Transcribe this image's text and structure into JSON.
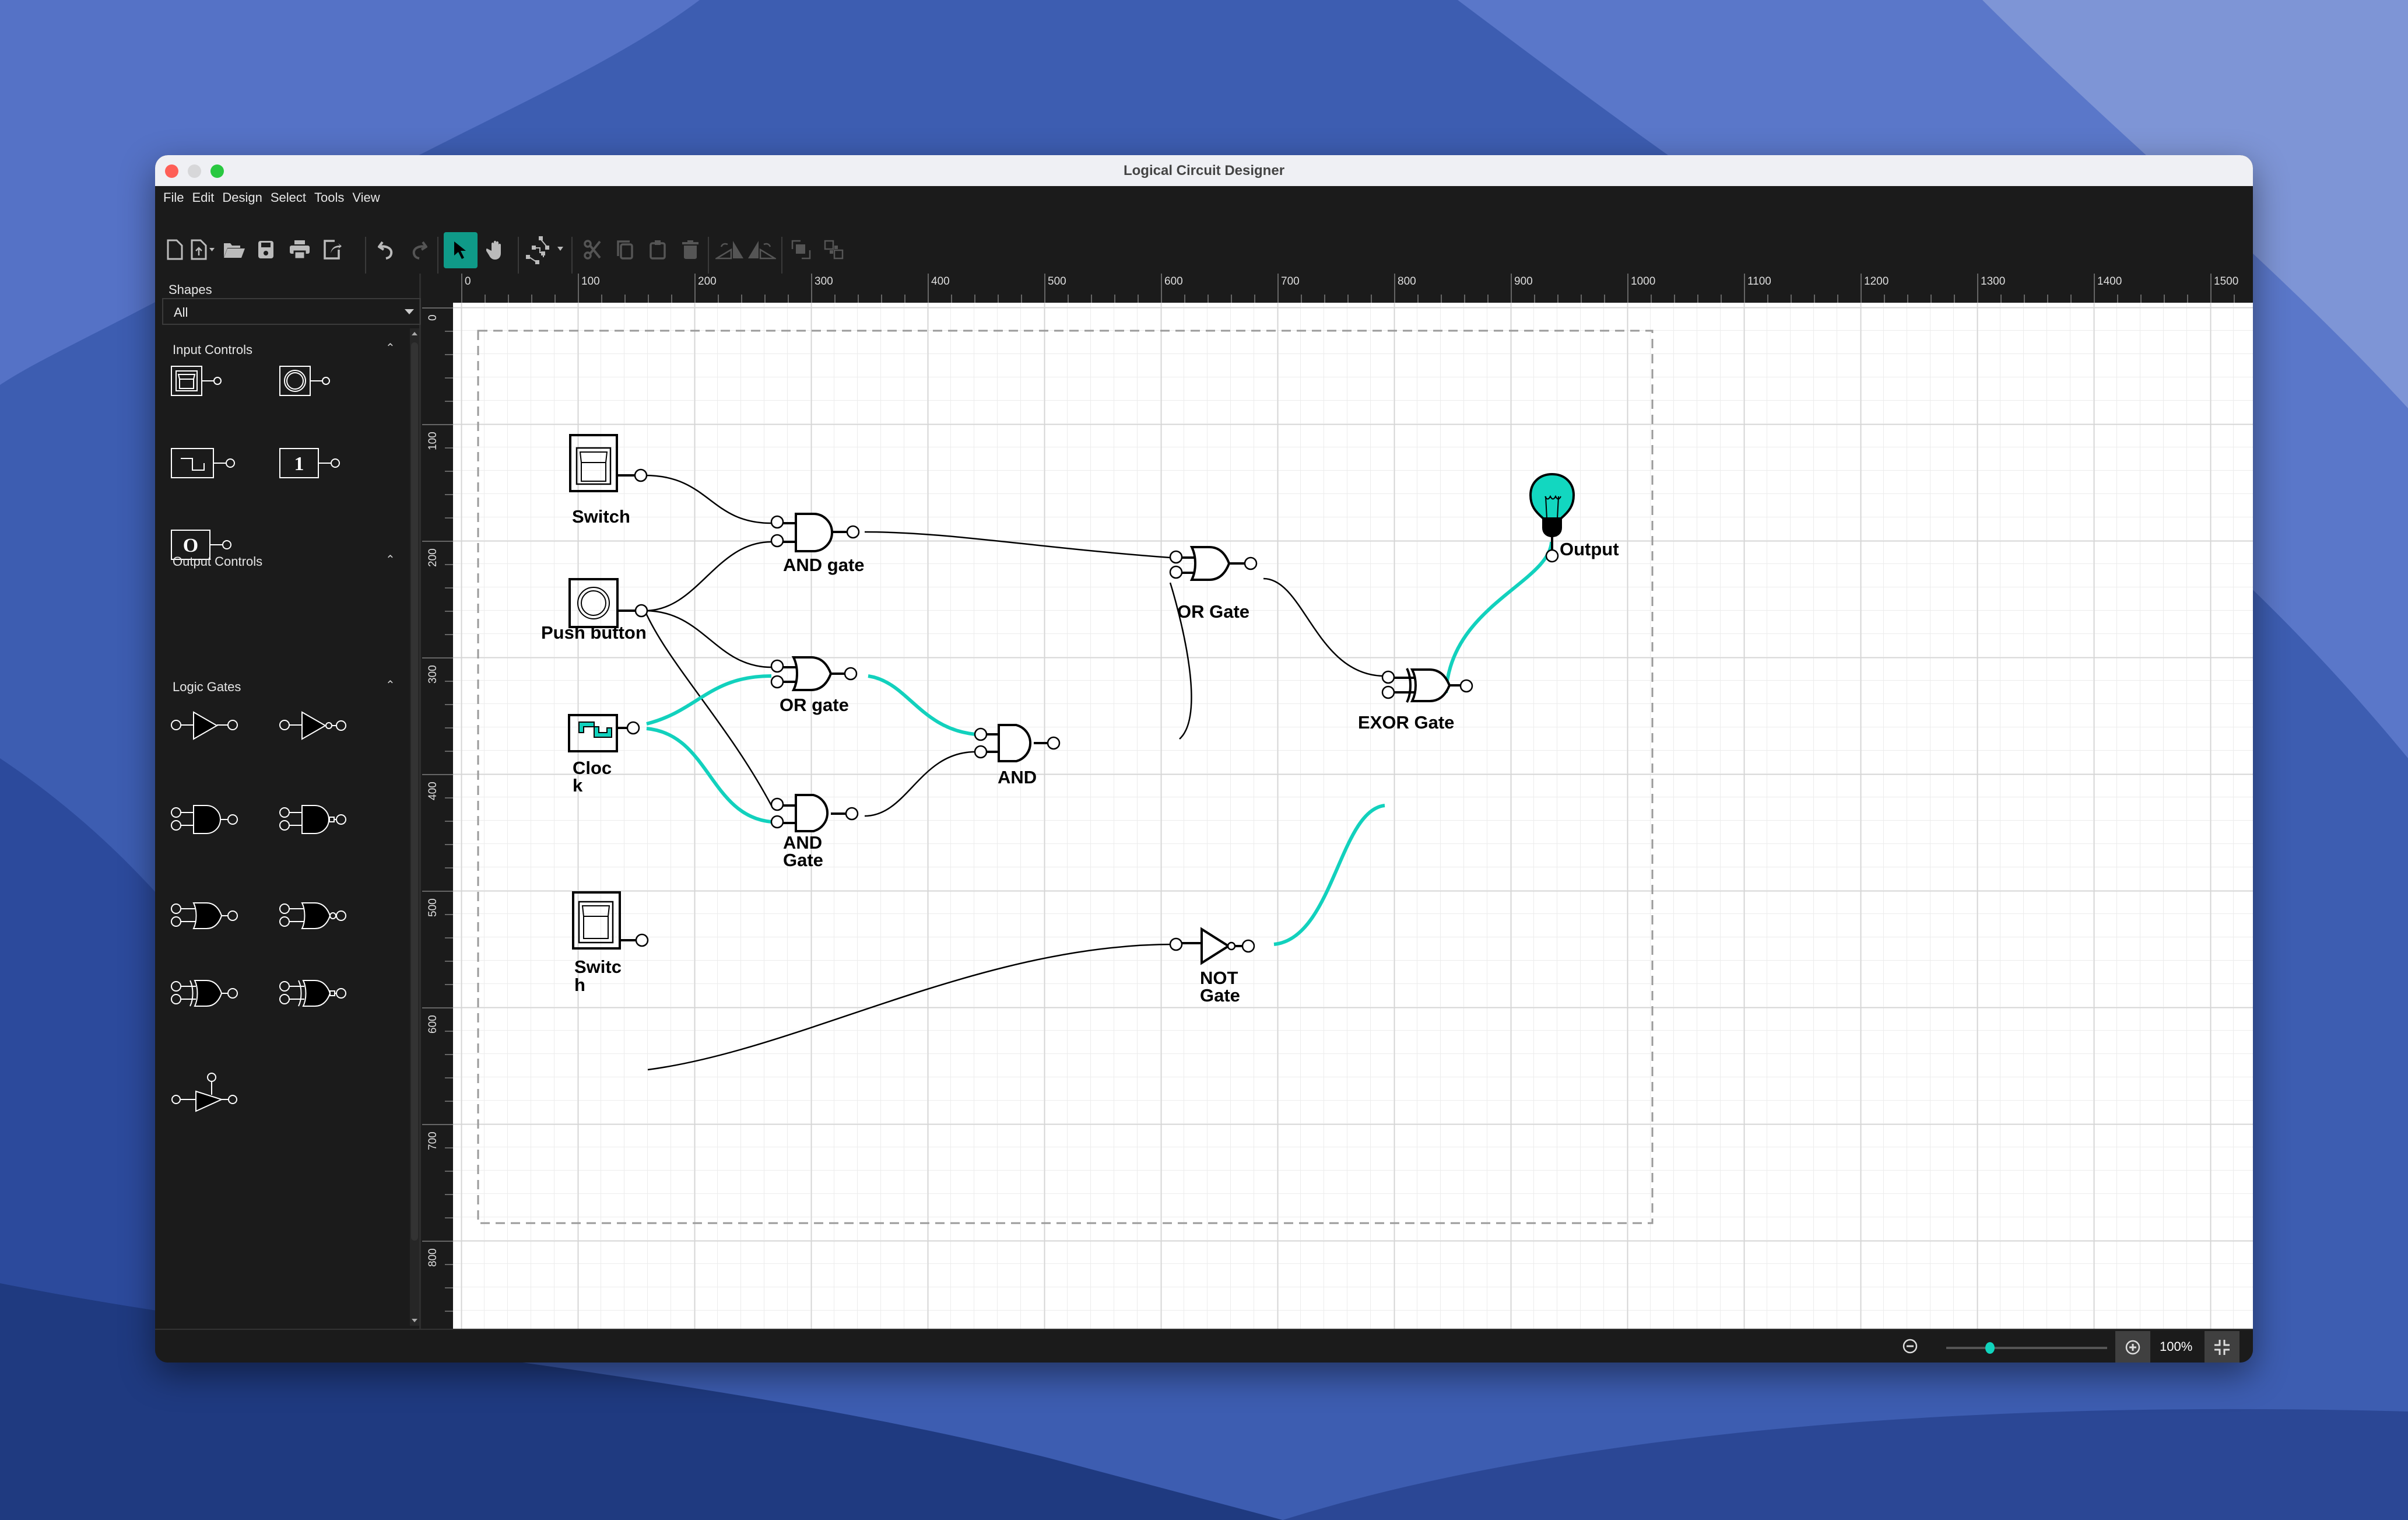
{
  "window": {
    "title": "Logical Circuit Designer"
  },
  "menu": {
    "items": [
      "File",
      "Edit",
      "Design",
      "Select",
      "Tools",
      "View"
    ]
  },
  "toolbar": {
    "buttons": [
      {
        "name": "new-document",
        "icon": "new-file-icon",
        "enabled": true
      },
      {
        "name": "import",
        "icon": "import-file-icon",
        "enabled": true,
        "dropdown": true
      },
      {
        "name": "open",
        "icon": "folder-open-icon",
        "enabled": true
      },
      {
        "name": "save",
        "icon": "save-icon",
        "enabled": true
      },
      {
        "name": "print",
        "icon": "print-icon",
        "enabled": true
      },
      {
        "name": "export",
        "icon": "export-icon",
        "enabled": true
      },
      {
        "name": "undo",
        "icon": "undo-icon",
        "enabled": true
      },
      {
        "name": "redo",
        "icon": "redo-icon",
        "enabled": false
      },
      {
        "name": "select-tool",
        "icon": "pointer-icon",
        "enabled": true,
        "active": true
      },
      {
        "name": "pan-tool",
        "icon": "hand-icon",
        "enabled": true
      },
      {
        "name": "connector",
        "icon": "connector-icon",
        "enabled": true,
        "dropdown": true
      },
      {
        "name": "cut",
        "icon": "scissors-icon",
        "enabled": false
      },
      {
        "name": "copy",
        "icon": "copy-icon",
        "enabled": false
      },
      {
        "name": "paste",
        "icon": "clipboard-icon",
        "enabled": false
      },
      {
        "name": "delete",
        "icon": "trash-icon",
        "enabled": false
      },
      {
        "name": "flip-horizontal",
        "icon": "flip-horizontal-icon",
        "enabled": false
      },
      {
        "name": "flip-vertical",
        "icon": "flip-vertical-icon",
        "enabled": false
      },
      {
        "name": "group",
        "icon": "group-icon",
        "enabled": false
      },
      {
        "name": "ungroup",
        "icon": "ungroup-icon",
        "enabled": false
      }
    ]
  },
  "sidebar": {
    "shapes_label": "Shapes",
    "filter_value": "All",
    "sections": [
      {
        "title": "Input Controls",
        "expanded": true,
        "items": [
          "toggle-switch",
          "push-button",
          "clock",
          "high-constant",
          "low-constant"
        ]
      },
      {
        "title": "Output Controls",
        "expanded": true,
        "items": []
      },
      {
        "title": "Logic Gates",
        "expanded": true,
        "items": [
          "buffer",
          "not",
          "and",
          "nand",
          "or",
          "nor",
          "xor",
          "xnor",
          "tri-state-buffer"
        ]
      }
    ],
    "constant_high_text": "1",
    "constant_low_text": "O"
  },
  "rulers": {
    "horizontal": [
      "0",
      "100",
      "200",
      "300",
      "400",
      "500",
      "600",
      "700",
      "800",
      "900",
      "1000",
      "1100",
      "1200",
      "1300",
      "1400",
      "1500"
    ],
    "vertical": [
      "0",
      "100",
      "200",
      "300",
      "400",
      "500",
      "600",
      "700",
      "800"
    ]
  },
  "diagram": {
    "nodes": [
      {
        "id": "switch1",
        "type": "switch",
        "label": "Switch"
      },
      {
        "id": "push1",
        "type": "push-button",
        "label": "Push button"
      },
      {
        "id": "clock1",
        "type": "clock",
        "label": "Cloc",
        "label2": "k"
      },
      {
        "id": "switch2",
        "type": "switch",
        "label": "Switc",
        "label2": "h"
      },
      {
        "id": "and1",
        "type": "and",
        "label": "AND gate"
      },
      {
        "id": "or1",
        "type": "or",
        "label": "OR gate"
      },
      {
        "id": "and2",
        "type": "and",
        "label": "AND",
        "label2": "Gate"
      },
      {
        "id": "and3",
        "type": "and",
        "label": "AND"
      },
      {
        "id": "or2",
        "type": "or",
        "label": "OR Gate"
      },
      {
        "id": "not1",
        "type": "not",
        "label": "NOT",
        "label2": "Gate"
      },
      {
        "id": "xor1",
        "type": "xor",
        "label": "EXOR Gate"
      },
      {
        "id": "out1",
        "type": "bulb",
        "label": "Output"
      }
    ],
    "active_wire_color": "#12d1bd",
    "bulb_color": "#12d7c0"
  },
  "status": {
    "zoom_percent": "100%",
    "zoom_level": 0.27
  }
}
